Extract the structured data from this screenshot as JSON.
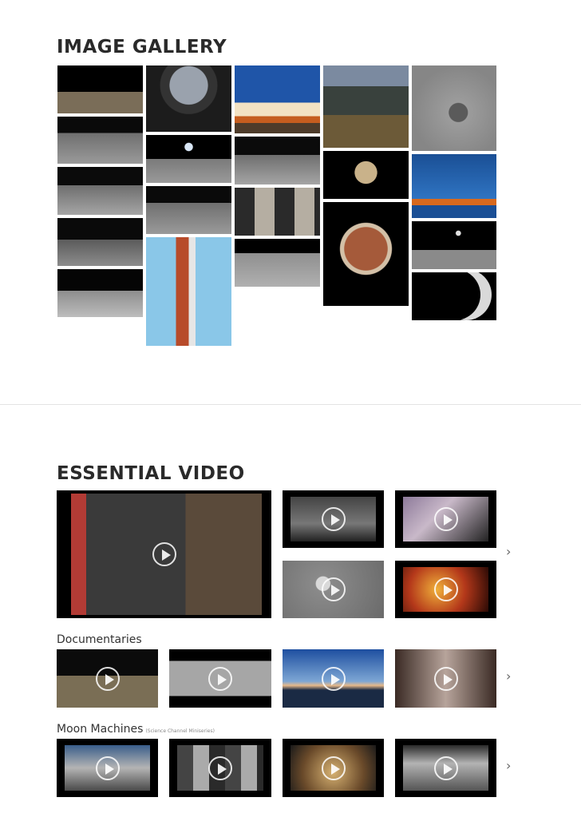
{
  "gallery": {
    "title": "IMAGE GALLERY"
  },
  "videos": {
    "title": "ESSENTIAL VIDEO",
    "documentaries_label": "Documentaries",
    "moon_machines_label": "Moon Machines",
    "moon_machines_sub": "(Science Channel Miniseries)"
  },
  "icons": {
    "play": "play-icon",
    "next": "chevron-right-icon"
  },
  "colors": {
    "title": "#2a2a2a",
    "divider": "#e3e3e3"
  }
}
